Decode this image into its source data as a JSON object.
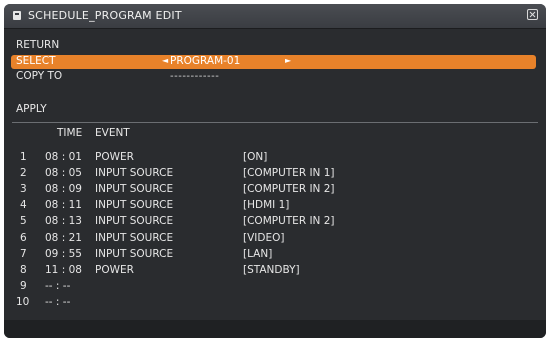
{
  "window": {
    "title": "SCHEDULE_PROGRAM EDIT",
    "title_icon": "schedule-icon",
    "close_icon": "close-icon"
  },
  "menu": {
    "return_label": "RETURN",
    "select_label": "SELECT",
    "select_value": "PROGRAM-01",
    "select_arrow_left": "◄",
    "select_arrow_right": "►",
    "copy_label": "COPY TO",
    "copy_value": "------------",
    "apply_label": "APPLY"
  },
  "table": {
    "headers": {
      "time": "TIME",
      "event": "EVENT"
    },
    "rows": [
      {
        "num": "1",
        "time": "08 : 01",
        "event": "POWER",
        "detail": "[ON]"
      },
      {
        "num": "2",
        "time": "08 : 05",
        "event": "INPUT SOURCE",
        "detail": "[COMPUTER IN 1]"
      },
      {
        "num": "3",
        "time": "08 : 09",
        "event": "INPUT SOURCE",
        "detail": "[COMPUTER IN 2]"
      },
      {
        "num": "4",
        "time": "08 : 11",
        "event": "INPUT SOURCE",
        "detail": "[HDMI 1]"
      },
      {
        "num": "5",
        "time": "08 : 13",
        "event": "INPUT SOURCE",
        "detail": "[COMPUTER IN 2]"
      },
      {
        "num": "6",
        "time": "08 : 21",
        "event": "INPUT SOURCE",
        "detail": "[VIDEO]"
      },
      {
        "num": "7",
        "time": "09 : 55",
        "event": "INPUT SOURCE",
        "detail": "[LAN]"
      },
      {
        "num": "8",
        "time": "11 : 08",
        "event": "POWER",
        "detail": "[STANDBY]"
      },
      {
        "num": "9",
        "time": "-- : --",
        "event": "",
        "detail": ""
      },
      {
        "num": "10",
        "time": "-- : --",
        "event": "",
        "detail": ""
      }
    ]
  },
  "colors": {
    "highlight": "#e8822a",
    "panel": "#2a2c2f",
    "text": "#e6e6e6"
  }
}
